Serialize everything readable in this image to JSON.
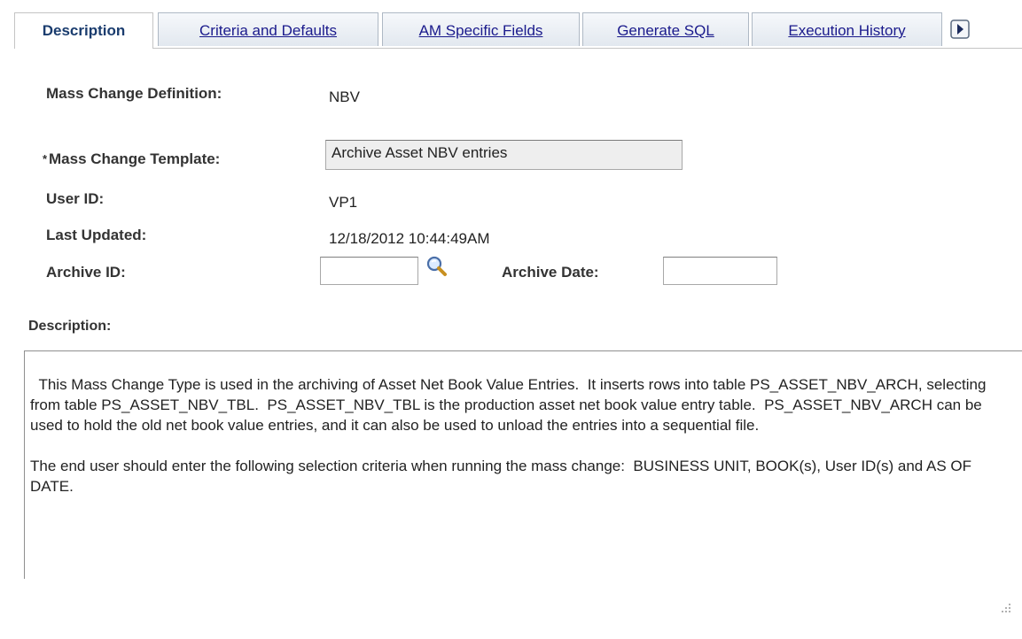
{
  "tabs": [
    {
      "label": "Description",
      "active": true
    },
    {
      "label": "Criteria and Defaults",
      "active": false
    },
    {
      "label": "AM Specific Fields",
      "active": false
    },
    {
      "label": "Generate SQL",
      "active": false
    },
    {
      "label": "Execution History",
      "active": false
    }
  ],
  "tab_more_icon": "scroll-right-icon",
  "form": {
    "definition_label": "Mass Change Definition:",
    "definition_value": "NBV",
    "required_marker": "*",
    "template_label": "Mass Change Template:",
    "template_value": "Archive Asset NBV entries",
    "user_label": "User ID:",
    "user_value": "VP1",
    "updated_label": "Last Updated:",
    "updated_value": "12/18/2012 10:44:49AM",
    "archive_id_label": "Archive ID:",
    "archive_id_value": "",
    "archive_date_label": "Archive Date:",
    "archive_date_value": "",
    "lookup_icon": "magnifier-lookup-icon"
  },
  "description": {
    "label": "Description:",
    "text": "This Mass Change Type is used in the archiving of Asset Net Book Value Entries.  It inserts rows into table PS_ASSET_NBV_ARCH, selecting from table PS_ASSET_NBV_TBL.  PS_ASSET_NBV_TBL is the production asset net book value entry table.  PS_ASSET_NBV_ARCH can be used to hold the old net book value entries, and it can also be used to unload the entries into a sequential file.\n\nThe end user should enter the following selection criteria when running the mass change:  BUSINESS UNIT, BOOK(s), User ID(s) and AS OF DATE."
  },
  "colors": {
    "tab_link": "#1a1a8c",
    "tab_active": "#1a3c6e",
    "label": "#333333"
  }
}
